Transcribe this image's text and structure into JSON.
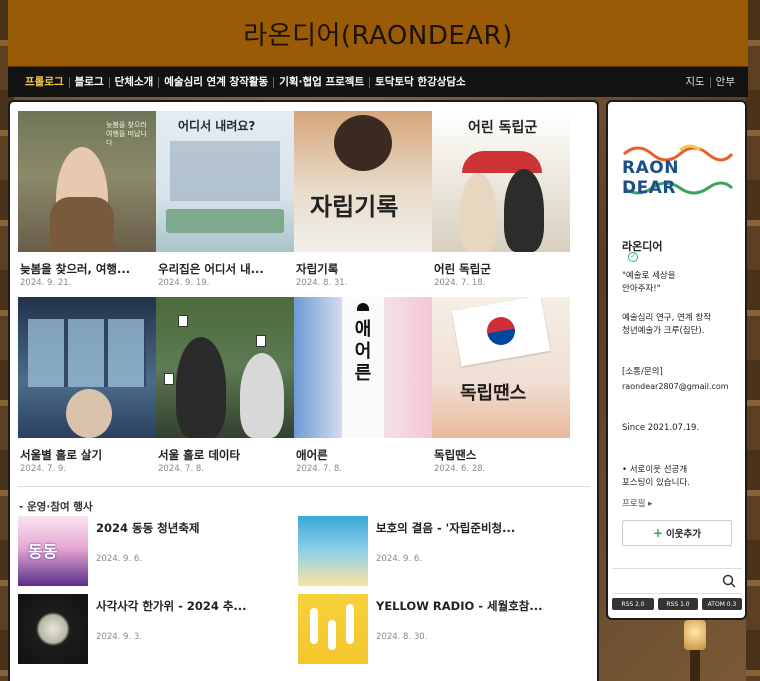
{
  "site": {
    "title": "라온디어(RAONDEAR)"
  },
  "nav": {
    "items": [
      {
        "label": "프롤로그",
        "active": true
      },
      {
        "label": "블로그"
      },
      {
        "label": "단체소개"
      },
      {
        "label": "예술심리 연계 창작활동"
      },
      {
        "label": "기획·협업 프로젝트"
      },
      {
        "label": "토닥토닥 한강상담소"
      }
    ],
    "right": [
      "지도",
      "안부"
    ]
  },
  "posts": [
    {
      "title": "늦봄을 찾으러, 여행...",
      "date": "2024. 9. 21.",
      "thumb_caption": "늦봄을 찾으러 여행을 떠납니다"
    },
    {
      "title": "우리집은 어디서 내...",
      "date": "2024. 9. 19.",
      "thumb_caption": "어디서 내려요?"
    },
    {
      "title": "자립기록",
      "date": "2024. 8. 31.",
      "thumb_caption": "자립기록"
    },
    {
      "title": "어린 독립군",
      "date": "2024. 7. 18.",
      "thumb_caption": "어린 독립군"
    },
    {
      "title": "서울별 홀로 살기",
      "date": "2024. 7. 9.",
      "thumb_caption": ""
    },
    {
      "title": "서울 홀로 데이타",
      "date": "2024. 7. 8.",
      "thumb_caption": ""
    },
    {
      "title": "애어른",
      "date": "2024. 7. 8.",
      "thumb_caption": "애어른"
    },
    {
      "title": "독립땐스",
      "date": "2024. 6. 28.",
      "thumb_caption": "독립땐스"
    }
  ],
  "events_section": {
    "title": "- 운영·참여 행사"
  },
  "events": [
    {
      "title": "2024 동동 청년축제",
      "date": "2024. 9. 6.",
      "thumb_caption": "동동"
    },
    {
      "title": "보호의 결음 - '자립준비청...",
      "date": "2024. 9. 6.",
      "thumb_caption": ""
    },
    {
      "title": "사각사각 한가위 - 2024 추...",
      "date": "2024. 9. 3.",
      "thumb_caption": ""
    },
    {
      "title": "YELLOW RADIO - 세월호참...",
      "date": "2024. 8. 30.",
      "thumb_caption": ""
    }
  ],
  "sidebar": {
    "logo_text": "RAON DEAR",
    "name": "라온디어",
    "quote": "\"예술로 세상을\n안아주자!\"",
    "desc": "예술심리 연구, 연계 창작\n청년예술가 크루(집단).",
    "contact_label": "[소통/문의]",
    "email": "raondear2807@gmail.com",
    "since": "Since  2021.07.19.",
    "notice": "• 서로이웃 선공개\n포스팅이 있습니다.",
    "profile_link": "프로필 ▸",
    "add_neighbor": "이웃추가",
    "rss": [
      "RSS 2.0",
      "RSS 1.0",
      "ATOM 0.3"
    ]
  },
  "colors": {
    "header": "#9a5b06",
    "nav": "#121212",
    "active": "#f3c84a"
  }
}
